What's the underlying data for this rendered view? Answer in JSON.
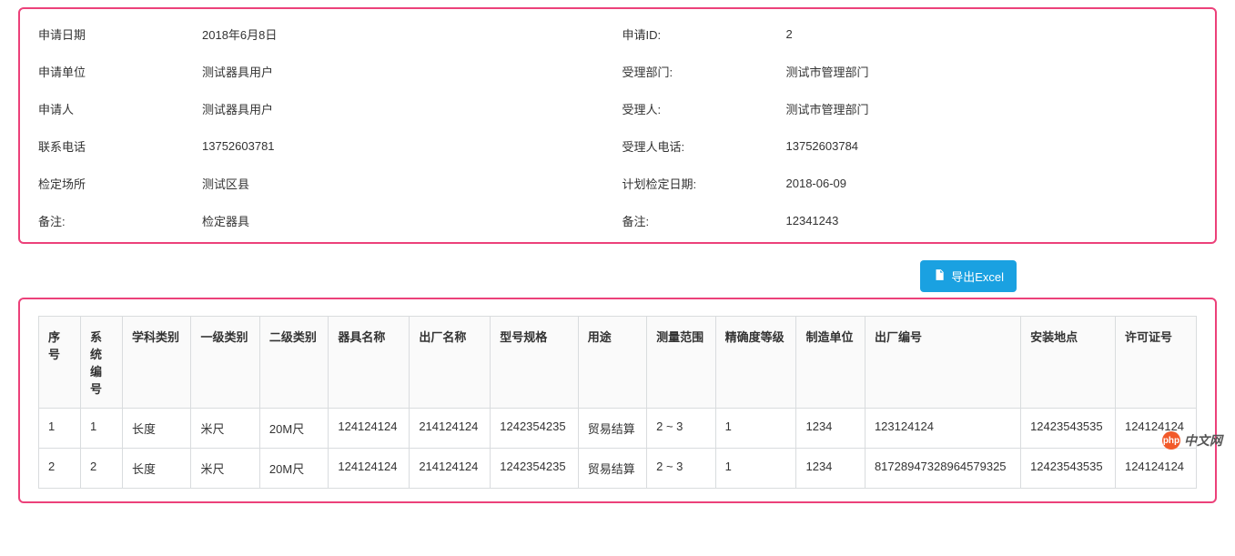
{
  "info": {
    "rows": [
      {
        "label_l": "申请日期",
        "value_l": "2018年6月8日",
        "label_r": "申请ID:",
        "value_r": "2"
      },
      {
        "label_l": "申请单位",
        "value_l": "测试器具用户",
        "label_r": "受理部门:",
        "value_r": "测试市管理部门"
      },
      {
        "label_l": "申请人",
        "value_l": "测试器具用户",
        "label_r": "受理人:",
        "value_r": "测试市管理部门"
      },
      {
        "label_l": "联系电话",
        "value_l": "13752603781",
        "label_r": "受理人电话:",
        "value_r": "13752603784"
      },
      {
        "label_l": "检定场所",
        "value_l": "测试区县",
        "label_r": "计划检定日期:",
        "value_r": "2018-06-09"
      },
      {
        "label_l": "备注:",
        "value_l": "检定器具",
        "label_r": "备注:",
        "value_r": "12341243"
      }
    ]
  },
  "toolbar": {
    "export_label": "导出Excel"
  },
  "table": {
    "headers": [
      "序号",
      "系统编号",
      "学科类别",
      "一级类别",
      "二级类别",
      "器具名称",
      "出厂名称",
      "型号规格",
      "用途",
      "测量范围",
      "精确度等级",
      "制造单位",
      "出厂编号",
      "安装地点",
      "许可证号"
    ],
    "rows": [
      [
        "1",
        "1",
        "长度",
        "米尺",
        "20M尺",
        "124124124",
        "214124124",
        "1242354235",
        "贸易结算",
        "2 ~ 3",
        "1",
        "1234",
        "123124124",
        "12423543535",
        "124124124"
      ],
      [
        "2",
        "2",
        "长度",
        "米尺",
        "20M尺",
        "124124124",
        "214124124",
        "1242354235",
        "贸易结算",
        "2 ~ 3",
        "1",
        "1234",
        "81728947328964579325",
        "12423543535",
        "124124124"
      ]
    ]
  },
  "watermark": {
    "logo_text": "php",
    "text": "中文网"
  }
}
